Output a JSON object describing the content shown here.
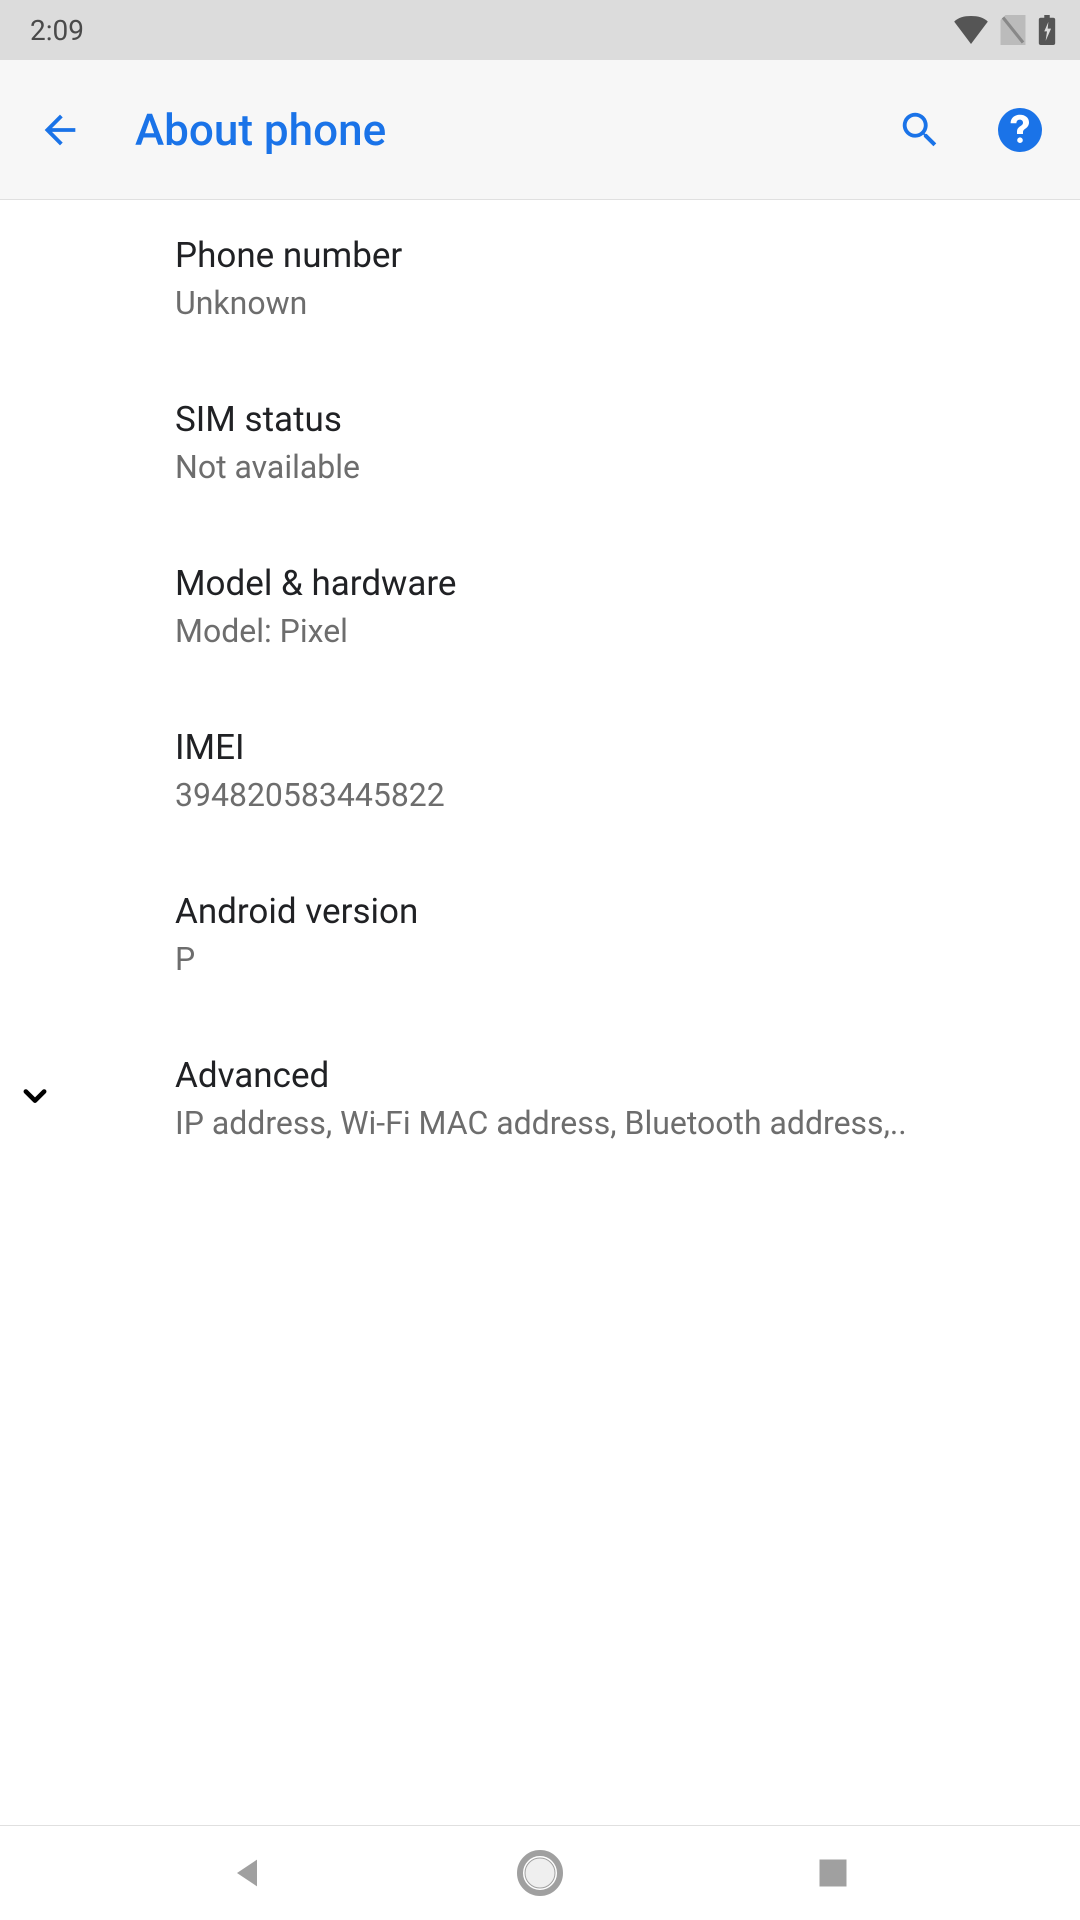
{
  "status": {
    "time": "2:09"
  },
  "header": {
    "title": "About phone"
  },
  "items": [
    {
      "title": "Phone number",
      "subtitle": "Unknown"
    },
    {
      "title": "SIM status",
      "subtitle": "Not available"
    },
    {
      "title": "Model & hardware",
      "subtitle": "Model: Pixel"
    },
    {
      "title": "IMEI",
      "subtitle": "394820583445822"
    },
    {
      "title": "Android version",
      "subtitle": "P"
    }
  ],
  "advanced": {
    "title": "Advanced",
    "subtitle": "IP address, Wi-Fi MAC address, Bluetooth address,.."
  }
}
